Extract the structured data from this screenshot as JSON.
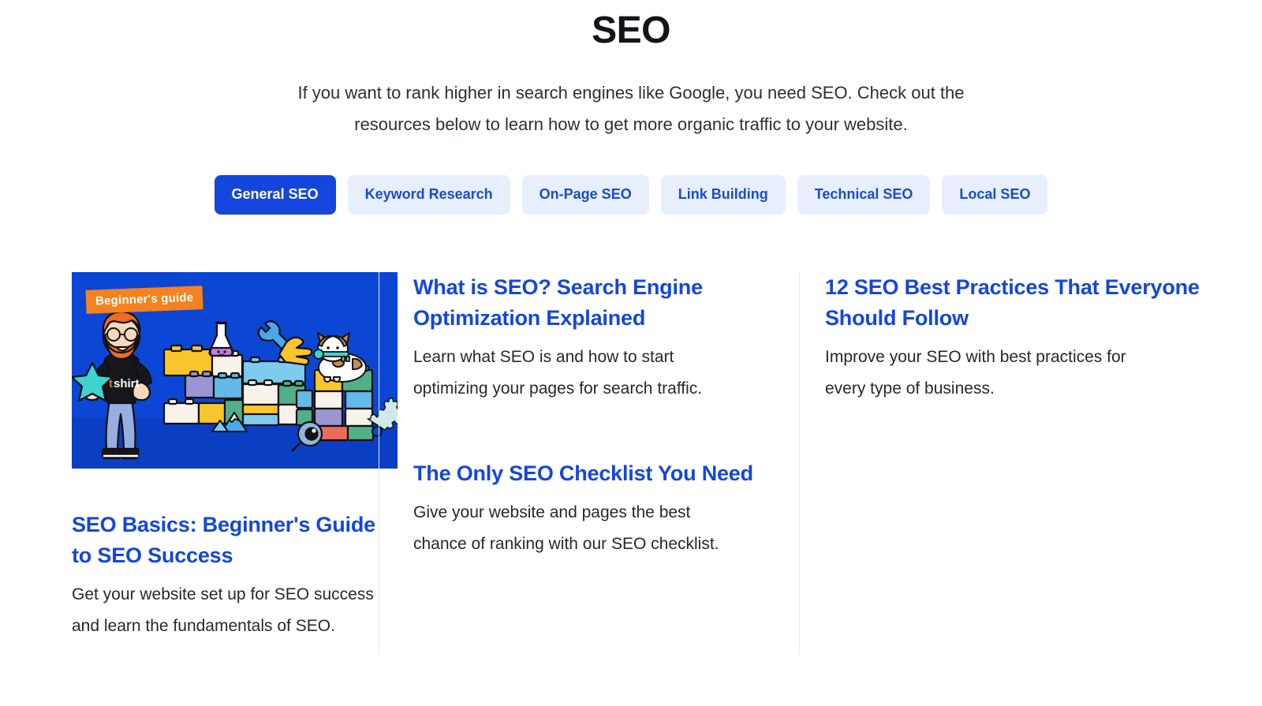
{
  "header": {
    "title": "SEO",
    "description": "If you want to rank higher in search engines like Google, you need SEO. Check out the resources below to learn how to get more organic traffic to your website."
  },
  "tabs": [
    {
      "label": "General SEO",
      "active": true
    },
    {
      "label": "Keyword Research",
      "active": false
    },
    {
      "label": "On-Page SEO",
      "active": false
    },
    {
      "label": "Link Building",
      "active": false
    },
    {
      "label": "Technical SEO",
      "active": false
    },
    {
      "label": "Local SEO",
      "active": false
    }
  ],
  "columns": [
    {
      "thumbnail": {
        "badge": "Beginner's guide",
        "alt": "Illustration of a person holding a star next to colorful toy building blocks, a flask, wrench, magnifying glass, gear and a corgi dog holding a key"
      },
      "entries": [
        {
          "title": "SEO Basics: Beginner's Guide to SEO Success",
          "description": "Get your website set up for SEO success and learn the fundamentals of SEO."
        }
      ]
    },
    {
      "entries": [
        {
          "title": "What is SEO? Search Engine Optimization Explained",
          "description": "Learn what SEO is and how to start optimizing your pages for search traffic."
        },
        {
          "title": "The Only SEO Checklist You Need",
          "description": "Give your website and pages the best chance of ranking with our SEO checklist."
        }
      ]
    },
    {
      "entries": [
        {
          "title": "12 SEO Best Practices That Everyone Should Follow",
          "description": "Improve your SEO with best practices for every type of business."
        }
      ]
    }
  ],
  "colors": {
    "accent_blue": "#1446dd",
    "tab_inactive_bg": "#e7effc",
    "tab_active_bg": "#1446dd",
    "badge_orange": "#f58220",
    "illustration_bg": "#0b46d5",
    "title_text": "#111418",
    "body_text": "#24282e",
    "divider": "#e7e9ec"
  }
}
